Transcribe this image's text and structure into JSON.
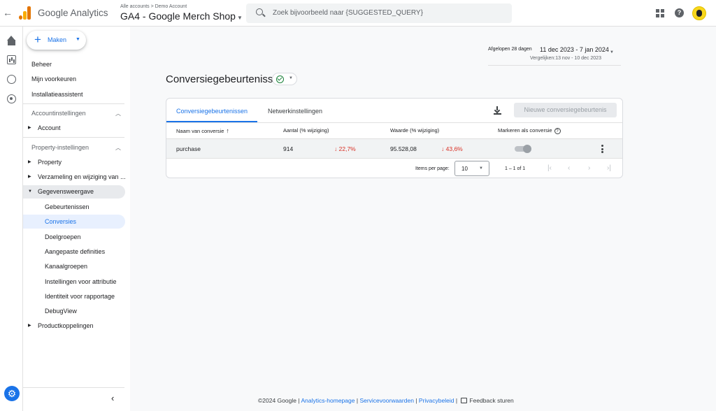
{
  "app": {
    "brand": "Google Analytics",
    "breadcrumb": "Alle accounts > Demo Account",
    "property": "GA4 - Google Merch Shop",
    "search_placeholder": "Zoek bijvoorbeeld naar {SUGGESTED_QUERY}"
  },
  "sidebar": {
    "create_label": "Maken",
    "top_links": [
      "Beheer",
      "Mijn voorkeuren",
      "Installatieassistent"
    ],
    "account_header": "Accountinstellingen",
    "account_items": [
      "Account"
    ],
    "property_header": "Property-instellingen",
    "property_items": [
      "Property",
      "Verzameling en wijziging van ...",
      "Gegevensweergave"
    ],
    "data_display_sub": [
      "Gebeurtenissen",
      "Conversies",
      "Doelgroepen",
      "Aangepaste definities",
      "Kanaalgroepen",
      "Instellingen voor attributie",
      "Identiteit voor rapportage",
      "DebugView"
    ],
    "product_links": "Productkoppelingen"
  },
  "date": {
    "label": "Afgelopen 28 dagen",
    "range": "11 dec 2023 - 7 jan 2024",
    "compare": "Vergelijken:13 nov - 10 dec 2023"
  },
  "page": {
    "title": "Conversiegebeurtenissen",
    "tabs": [
      "Conversiegebeurtenissen",
      "Netwerkinstellingen"
    ],
    "new_button": "Nieuwe conversiegebeurtenis"
  },
  "table": {
    "headers": [
      "Naam van conversie",
      "Aantal (% wijziging)",
      "Waarde (% wijziging)",
      "Markeren als conversie"
    ],
    "sort_arrow": "↑",
    "rows": [
      {
        "name": "purchase",
        "count": "914",
        "count_change": "22,7%",
        "value": "95.528,08",
        "value_change": "43,6%",
        "down_arrow": "↓"
      }
    ]
  },
  "pagination": {
    "label": "Items per page:",
    "per_page": "10",
    "range": "1 – 1 of 1"
  },
  "footer": {
    "copyright": "©2024 Google",
    "sep": "|",
    "links": [
      "Analytics-homepage",
      "Servicevoorwaarden",
      "Privacybeleid"
    ],
    "feedback": "Feedback sturen"
  },
  "colors": {
    "accent": "#1a73e8",
    "negative": "#d93025",
    "success": "#188038",
    "ga_orange": "#f9ab00",
    "ga_dark_orange": "#e37400"
  }
}
